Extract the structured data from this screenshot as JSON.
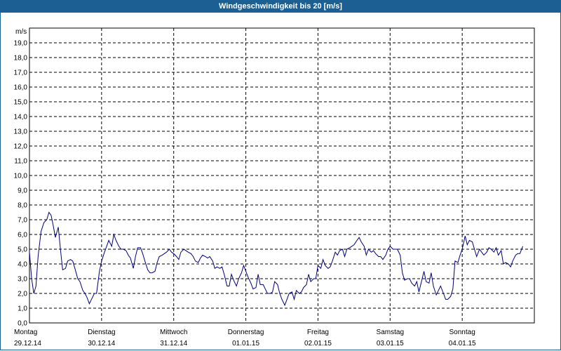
{
  "window": {
    "title": "Windgeschwindigkeit bis 20 [m/s]"
  },
  "chart_data": {
    "type": "line",
    "title": "Windgeschwindigkeit bis 20 [m/s]",
    "ylabel": "m/s",
    "ylim": [
      0,
      20
    ],
    "y_ticks": [
      "0,0",
      "1,0",
      "2,0",
      "3,0",
      "4,0",
      "5,0",
      "6,0",
      "7,0",
      "8,0",
      "9,0",
      "10,0",
      "11,0",
      "12,0",
      "13,0",
      "14,0",
      "15,0",
      "16,0",
      "17,0",
      "18,0",
      "19,0"
    ],
    "days": [
      {
        "name": "Montag",
        "date": "29.12.14"
      },
      {
        "name": "Dienstag",
        "date": "30.12.14"
      },
      {
        "name": "Mittwoch",
        "date": "31.12.14"
      },
      {
        "name": "Donnerstag",
        "date": "01.01.15"
      },
      {
        "name": "Freitag",
        "date": "02.01.15"
      },
      {
        "name": "Samstag",
        "date": "03.01.15"
      },
      {
        "name": "Sonntag",
        "date": "04.01.15"
      }
    ],
    "xlim": [
      0,
      7
    ],
    "grid": true,
    "line_color": "#00007f",
    "series": [
      {
        "values": [
          [
            0.0,
            4.8
          ],
          [
            0.03,
            3.0
          ],
          [
            0.06,
            2.0
          ],
          [
            0.09,
            2.5
          ],
          [
            0.12,
            4.5
          ],
          [
            0.16,
            6.2
          ],
          [
            0.2,
            6.8
          ],
          [
            0.24,
            7.0
          ],
          [
            0.27,
            7.5
          ],
          [
            0.3,
            7.3
          ],
          [
            0.33,
            6.6
          ],
          [
            0.36,
            5.8
          ],
          [
            0.4,
            6.5
          ],
          [
            0.43,
            5.0
          ],
          [
            0.46,
            3.6
          ],
          [
            0.5,
            3.7
          ],
          [
            0.53,
            4.2
          ],
          [
            0.57,
            4.3
          ],
          [
            0.6,
            4.2
          ],
          [
            0.63,
            3.7
          ],
          [
            0.67,
            3.0
          ],
          [
            0.7,
            2.8
          ],
          [
            0.74,
            2.2
          ],
          [
            0.77,
            2.0
          ],
          [
            0.8,
            1.7
          ],
          [
            0.83,
            1.3
          ],
          [
            0.87,
            1.7
          ],
          [
            0.9,
            2.0
          ],
          [
            0.93,
            2.0
          ],
          [
            0.97,
            3.5
          ],
          [
            1.0,
            4.2
          ],
          [
            1.04,
            4.8
          ],
          [
            1.07,
            5.2
          ],
          [
            1.1,
            5.6
          ],
          [
            1.14,
            5.2
          ],
          [
            1.17,
            6.0
          ],
          [
            1.2,
            5.6
          ],
          [
            1.24,
            5.2
          ],
          [
            1.27,
            5.0
          ],
          [
            1.3,
            5.0
          ],
          [
            1.34,
            4.9
          ],
          [
            1.37,
            4.6
          ],
          [
            1.4,
            4.4
          ],
          [
            1.44,
            3.7
          ],
          [
            1.47,
            4.5
          ],
          [
            1.5,
            5.1
          ],
          [
            1.54,
            5.1
          ],
          [
            1.57,
            4.7
          ],
          [
            1.6,
            4.2
          ],
          [
            1.64,
            3.6
          ],
          [
            1.67,
            3.4
          ],
          [
            1.7,
            3.4
          ],
          [
            1.74,
            3.5
          ],
          [
            1.77,
            4.1
          ],
          [
            1.8,
            4.5
          ],
          [
            1.84,
            4.6
          ],
          [
            1.87,
            4.7
          ],
          [
            1.9,
            4.8
          ],
          [
            1.94,
            5.0
          ],
          [
            1.97,
            4.8
          ],
          [
            2.0,
            4.7
          ],
          [
            2.04,
            4.5
          ],
          [
            2.07,
            4.3
          ],
          [
            2.1,
            4.8
          ],
          [
            2.14,
            5.0
          ],
          [
            2.17,
            4.9
          ],
          [
            2.2,
            4.8
          ],
          [
            2.24,
            4.7
          ],
          [
            2.27,
            4.5
          ],
          [
            2.3,
            4.2
          ],
          [
            2.34,
            4.1
          ],
          [
            2.37,
            4.4
          ],
          [
            2.4,
            4.6
          ],
          [
            2.44,
            4.5
          ],
          [
            2.47,
            4.4
          ],
          [
            2.5,
            4.5
          ],
          [
            2.54,
            4.2
          ],
          [
            2.57,
            3.7
          ],
          [
            2.6,
            3.8
          ],
          [
            2.64,
            3.7
          ],
          [
            2.67,
            3.8
          ],
          [
            2.7,
            3.3
          ],
          [
            2.74,
            2.5
          ],
          [
            2.77,
            2.5
          ],
          [
            2.8,
            3.3
          ],
          [
            2.84,
            2.8
          ],
          [
            2.87,
            2.5
          ],
          [
            2.9,
            3.0
          ],
          [
            2.94,
            3.4
          ],
          [
            2.97,
            3.9
          ],
          [
            3.0,
            3.5
          ],
          [
            3.04,
            3.0
          ],
          [
            3.07,
            2.7
          ],
          [
            3.1,
            2.3
          ],
          [
            3.14,
            2.4
          ],
          [
            3.17,
            3.3
          ],
          [
            3.2,
            2.6
          ],
          [
            3.24,
            2.6
          ],
          [
            3.27,
            2.3
          ],
          [
            3.3,
            2.0
          ],
          [
            3.34,
            2.0
          ],
          [
            3.37,
            2.1
          ],
          [
            3.4,
            2.8
          ],
          [
            3.44,
            2.6
          ],
          [
            3.47,
            2.0
          ],
          [
            3.5,
            1.6
          ],
          [
            3.54,
            1.2
          ],
          [
            3.57,
            1.6
          ],
          [
            3.6,
            2.0
          ],
          [
            3.64,
            2.1
          ],
          [
            3.67,
            1.6
          ],
          [
            3.7,
            2.2
          ],
          [
            3.74,
            2.0
          ],
          [
            3.77,
            2.1
          ],
          [
            3.8,
            2.4
          ],
          [
            3.84,
            2.6
          ],
          [
            3.87,
            3.3
          ],
          [
            3.9,
            2.8
          ],
          [
            3.94,
            3.0
          ],
          [
            3.97,
            3.0
          ],
          [
            4.0,
            3.9
          ],
          [
            4.04,
            3.7
          ],
          [
            4.07,
            4.3
          ],
          [
            4.1,
            3.9
          ],
          [
            4.14,
            3.7
          ],
          [
            4.17,
            3.8
          ],
          [
            4.2,
            4.2
          ],
          [
            4.24,
            4.8
          ],
          [
            4.27,
            4.6
          ],
          [
            4.3,
            4.9
          ],
          [
            4.34,
            5.0
          ],
          [
            4.37,
            4.5
          ],
          [
            4.4,
            5.0
          ],
          [
            4.44,
            5.1
          ],
          [
            4.47,
            5.2
          ],
          [
            4.5,
            5.3
          ],
          [
            4.54,
            5.6
          ],
          [
            4.57,
            5.8
          ],
          [
            4.6,
            5.5
          ],
          [
            4.64,
            5.2
          ],
          [
            4.67,
            4.6
          ],
          [
            4.7,
            5.0
          ],
          [
            4.74,
            4.8
          ],
          [
            4.77,
            4.9
          ],
          [
            4.8,
            4.7
          ],
          [
            4.84,
            4.5
          ],
          [
            4.87,
            4.5
          ],
          [
            4.9,
            4.3
          ],
          [
            4.94,
            4.6
          ],
          [
            4.97,
            5.0
          ],
          [
            5.0,
            5.2
          ],
          [
            5.04,
            5.0
          ],
          [
            5.07,
            5.0
          ],
          [
            5.1,
            5.0
          ],
          [
            5.14,
            4.6
          ],
          [
            5.17,
            3.4
          ],
          [
            5.2,
            2.9
          ],
          [
            5.24,
            3.0
          ],
          [
            5.27,
            3.0
          ],
          [
            5.3,
            2.7
          ],
          [
            5.34,
            2.5
          ],
          [
            5.37,
            2.8
          ],
          [
            5.4,
            2.1
          ],
          [
            5.44,
            2.9
          ],
          [
            5.47,
            3.5
          ],
          [
            5.5,
            2.8
          ],
          [
            5.54,
            2.7
          ],
          [
            5.57,
            3.4
          ],
          [
            5.6,
            2.5
          ],
          [
            5.64,
            1.9
          ],
          [
            5.67,
            2.2
          ],
          [
            5.7,
            2.5
          ],
          [
            5.74,
            2.0
          ],
          [
            5.77,
            1.6
          ],
          [
            5.8,
            1.6
          ],
          [
            5.84,
            1.8
          ],
          [
            5.87,
            2.3
          ],
          [
            5.9,
            4.2
          ],
          [
            5.94,
            4.1
          ],
          [
            5.97,
            4.6
          ],
          [
            6.0,
            5.0
          ],
          [
            6.04,
            5.9
          ],
          [
            6.07,
            5.3
          ],
          [
            6.1,
            5.6
          ],
          [
            6.14,
            5.5
          ],
          [
            6.17,
            5.0
          ],
          [
            6.2,
            4.5
          ],
          [
            6.24,
            5.0
          ],
          [
            6.27,
            4.8
          ],
          [
            6.3,
            4.6
          ],
          [
            6.34,
            4.8
          ],
          [
            6.37,
            5.1
          ],
          [
            6.4,
            5.0
          ],
          [
            6.44,
            4.8
          ],
          [
            6.47,
            5.1
          ],
          [
            6.5,
            4.6
          ],
          [
            6.54,
            4.9
          ],
          [
            6.57,
            4.0
          ],
          [
            6.6,
            4.1
          ],
          [
            6.64,
            4.0
          ],
          [
            6.67,
            3.8
          ],
          [
            6.7,
            4.2
          ],
          [
            6.74,
            4.6
          ],
          [
            6.77,
            4.7
          ],
          [
            6.8,
            4.7
          ],
          [
            6.84,
            5.2
          ]
        ]
      }
    ]
  }
}
